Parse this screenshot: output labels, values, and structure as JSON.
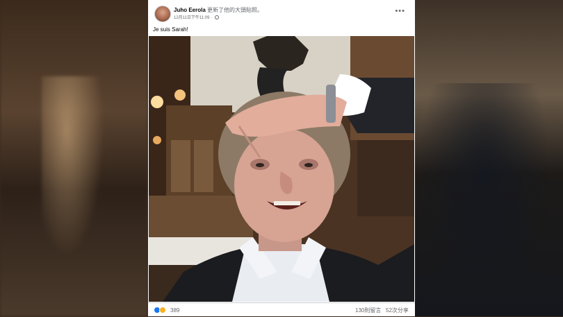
{
  "post": {
    "author": "Juho Eerola",
    "action": "更新了他的大頭貼照",
    "dot": "。",
    "timestamp": "12月11日下午11:09",
    "sep": "·",
    "caption": "Je suis Sarah!"
  },
  "footer": {
    "reaction_count": "389",
    "comments": "130則留言",
    "shares": "52次分享"
  },
  "icons": {
    "more": "more-options-icon",
    "privacy": "globe-icon",
    "reactions": [
      "like-reaction-icon",
      "haha-reaction-icon"
    ]
  },
  "colors": {
    "link_blue": "#1877f2",
    "muted_text": "#65676b"
  }
}
